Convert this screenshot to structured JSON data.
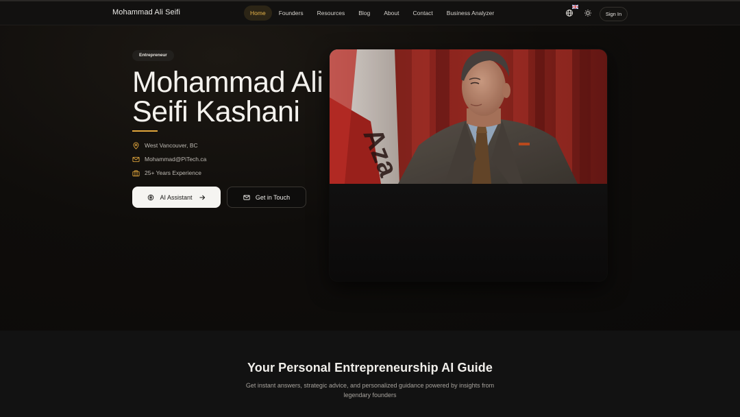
{
  "nav": {
    "brand": "Mohammad Ali Seifi",
    "links": [
      "Home",
      "Founders",
      "Resources",
      "Blog",
      "About",
      "Contact",
      "Business Analyzer"
    ],
    "active_link": "Home",
    "language_icon": "globe-icon",
    "language_flag": "uk-flag-icon",
    "theme_icon": "sun-icon",
    "sign_in": "Sign In"
  },
  "hero": {
    "badge": "Entrepreneur",
    "title_line1": "Mohammad Ali",
    "title_line2": "Seifi Kashani",
    "info": [
      {
        "icon": "map-pin-icon",
        "text": "West Vancouver, BC"
      },
      {
        "icon": "mail-icon",
        "text": "Mohammad@PiTech.ca"
      },
      {
        "icon": "briefcase-icon",
        "text": "25+ Years Experience"
      }
    ],
    "primary_button": "AI Assistant",
    "secondary_button": "Get in Touch",
    "photo_flag_text": "Aza",
    "accent_color": "#e1a63c"
  },
  "guide": {
    "title": "Your Personal Entrepreneurship AI Guide",
    "subtitle": "Get instant answers, strategic advice, and personalized guidance powered by insights from legendary founders"
  }
}
